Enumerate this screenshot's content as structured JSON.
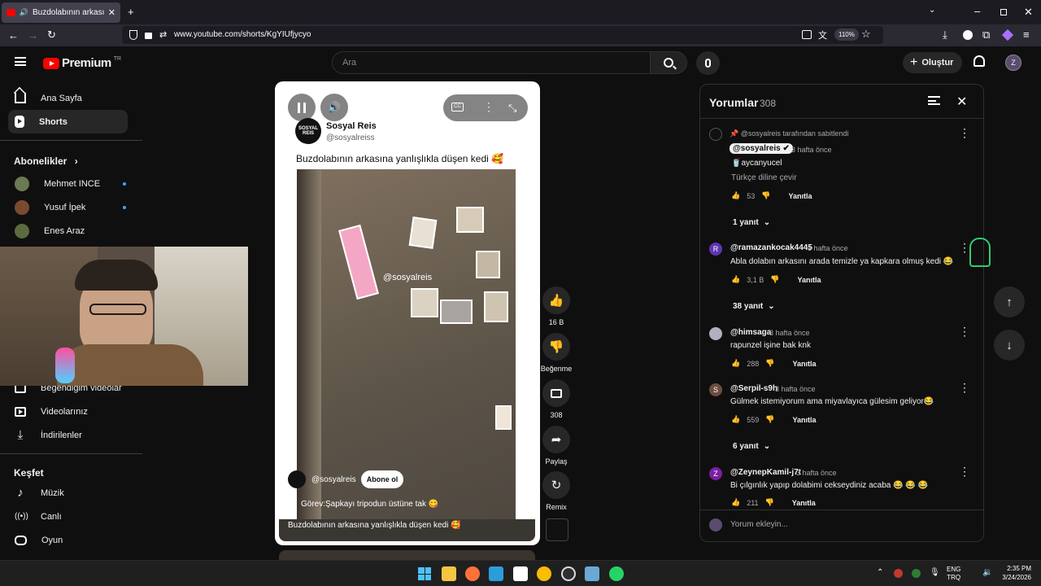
{
  "browser": {
    "tab_title": "Buzdolabının arkasına yanlışl",
    "url": "www.youtube.com/shorts/KgYIUfjycyo",
    "zoom": "110%"
  },
  "yt": {
    "logo_text": "Premium",
    "logo_country": "TR",
    "search_placeholder": "Ara",
    "create_label": "Oluştur"
  },
  "sidebar": {
    "home": "Ana Sayfa",
    "shorts": "Shorts",
    "subs_heading": "Abonelikler",
    "subs": [
      {
        "name": "Mehmet INCE",
        "color": "#6b7a52"
      },
      {
        "name": "Yusuf İpek",
        "color": "#7a4a30"
      },
      {
        "name": "Enes Araz",
        "color": "#5b6b3f"
      }
    ],
    "liked": "Beğendiğim videolar",
    "your_videos": "Videolarınız",
    "downloads": "İndirilenler",
    "explore_heading": "Keşfet",
    "music": "Müzik",
    "live": "Canlı",
    "gaming": "Oyun"
  },
  "short": {
    "channel_name": "Sosyal Reis",
    "channel_handle": "@sosyalreiss",
    "title": "Buzdolabının arkasına yanlışlıkla düşen kedi 🥰",
    "watermark": "@sosyalreis",
    "overlay_handle": "@sosyalreis",
    "subscribe_label": "Abone ol",
    "task_text": "Görev:Şapkayı tripodun üstüne tak 😋",
    "bottom_title": "Buzdolabının arkasına yanlışlıkla düşen kedi 🥰",
    "logo_text": "SOSYAL REIS"
  },
  "actions": {
    "likes": "16 B",
    "dislike": "Beğenme",
    "comments": "308",
    "share": "Paylaş",
    "remix": "Remix"
  },
  "comments_panel": {
    "title": "Yorumlar",
    "count": "308",
    "pinned_by": "@sosyalreis tarafından sabitlendi",
    "add_placeholder": "Yorum ekleyin...",
    "reply_label": "Yanıtla",
    "items": [
      {
        "user": "@sosyalreis",
        "time": "3 hafta önce",
        "text": "aycanyucel",
        "translate": "Türkçe diline çevir",
        "likes": "53",
        "replies": "1 yanıt"
      },
      {
        "user": "@ramazankocak4445",
        "time": "3 hafta önce",
        "text": "Abla dolabın arkasını arada temizle ya kapkara olmuş kedi 😂",
        "likes": "3,1 B",
        "replies": "38 yanıt",
        "avatar_letter": "R",
        "avatar_color": "#5e35b1"
      },
      {
        "user": "@himsaga",
        "time": "3 hafta önce",
        "text": "rapunzel işine bak knk",
        "likes": "288"
      },
      {
        "user": "@Serpil-s9h",
        "time": "3 hafta önce",
        "text": "Gülmek istemiyorum ama miyavlayıca gülesim geliyor😂",
        "likes": "559",
        "replies": "6 yanıt",
        "avatar_letter": "S",
        "avatar_color": "#6d4c41"
      },
      {
        "user": "@ZeynepKamil-j7t",
        "time": "3 hafta önce",
        "text": "Bi çılgınlık yapıp dolabimi cekseydiniz acaba 😂 😂 😂",
        "likes": "211",
        "avatar_letter": "Z",
        "avatar_color": "#7b1fa2"
      }
    ]
  },
  "taskbar": {
    "lang": "ENG",
    "lang2": "TRQ",
    "time": "2:35 PM",
    "date": "3/24/2026"
  }
}
